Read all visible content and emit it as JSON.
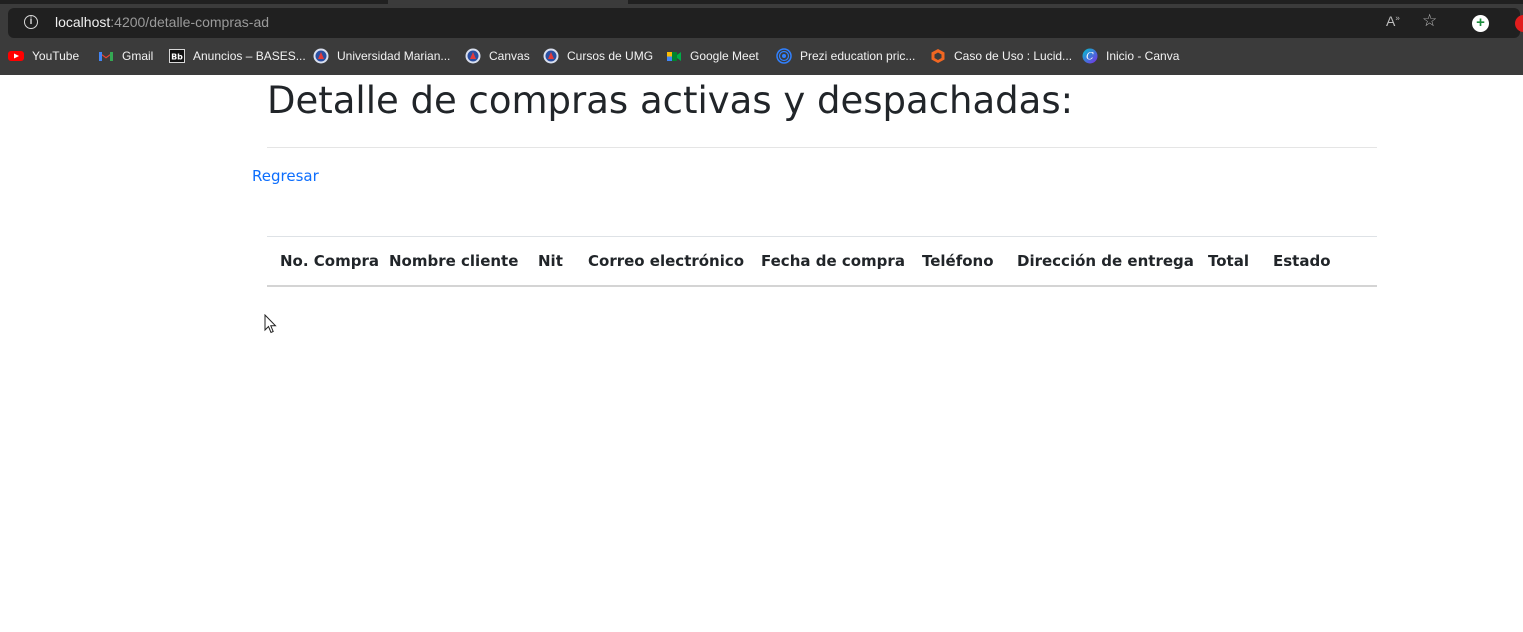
{
  "browser": {
    "url_host": "localhost",
    "url_rest": ":4200/detalle-compras-ad",
    "info_icon": "info-icon",
    "bookmarks": [
      {
        "label": "YouTube",
        "icon": "youtube-icon",
        "color": "#ff0000"
      },
      {
        "label": "Gmail",
        "icon": "gmail-icon",
        "color": "#ea4335"
      },
      {
        "label": "Anuncios – BASES...",
        "icon": "blackboard-icon",
        "color": "#000000"
      },
      {
        "label": "Universidad Marian...",
        "icon": "umg-icon",
        "color": "#2a4ea0"
      },
      {
        "label": "Canvas",
        "icon": "umg-icon",
        "color": "#2a4ea0"
      },
      {
        "label": "Cursos de UMG",
        "icon": "umg-icon",
        "color": "#2a4ea0"
      },
      {
        "label": "Google Meet",
        "icon": "google-meet-icon",
        "color": "#00832d"
      },
      {
        "label": "Prezi education pric...",
        "icon": "prezi-icon",
        "color": "#3181ff"
      },
      {
        "label": "Caso de Uso : Lucid...",
        "icon": "lucid-icon",
        "color": "#f26722"
      },
      {
        "label": "Inicio - Canva",
        "icon": "canva-icon",
        "color": "#7d2ae8"
      }
    ]
  },
  "page": {
    "title": "Detalle de compras activas y despachadas:",
    "back_link": "Regresar",
    "link_color": "#0d6efd"
  },
  "table": {
    "columns": [
      "No. Compra",
      "Nombre cliente",
      "Nit",
      "Correo electrónico",
      "Fecha de compra",
      "Teléfono",
      "Dirección de entrega",
      "Total",
      "Estado"
    ],
    "rows": []
  }
}
